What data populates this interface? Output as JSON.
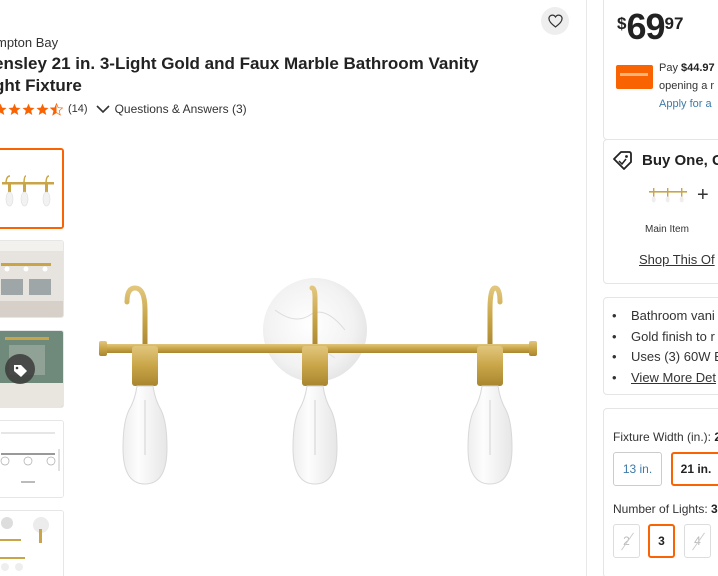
{
  "product": {
    "brand": "mpton Bay",
    "title_line1": "ensley 21 in. 3-Light Gold and Faux Marble Bathroom Vanity",
    "title_line2": "ght Fixture",
    "rating": 4.5,
    "review_count": "(14)",
    "qa_label": "Questions & Answers (3)"
  },
  "thumbnails": [
    {
      "name": "vanity-light-front",
      "selected": true
    },
    {
      "name": "bathroom-scene"
    },
    {
      "name": "green-bathroom-scene",
      "icon": "tag-icon"
    },
    {
      "name": "dimension-diagram"
    },
    {
      "name": "detail-collage"
    }
  ],
  "price": {
    "dollar_sign": "$",
    "whole": "69",
    "cents": "97"
  },
  "financing": {
    "pay_prefix": "Pay ",
    "pay_amount": "$44.97",
    "open_text": "opening a r",
    "apply_text": "Apply for a"
  },
  "bogo": {
    "heading": "Buy One, G",
    "main_item_label": "Main Item",
    "plus": "+",
    "shop_link": "Shop This Of"
  },
  "features": [
    "Bathroom vani",
    "Gold finish to r",
    "Uses (3) 60W E"
  ],
  "view_more": "View More Det",
  "options": {
    "width_label": "Fixture Width (in.): ",
    "width_value": "2",
    "widths": [
      "13 in.",
      "21 in."
    ],
    "lights_label": "Number of Lights: ",
    "lights_value": "3",
    "lights": [
      "2",
      "3",
      "4"
    ]
  },
  "colors": {
    "accent": "#f96302",
    "link": "#3e7aa8",
    "star": "#f96302",
    "gold": "#c9a548"
  }
}
